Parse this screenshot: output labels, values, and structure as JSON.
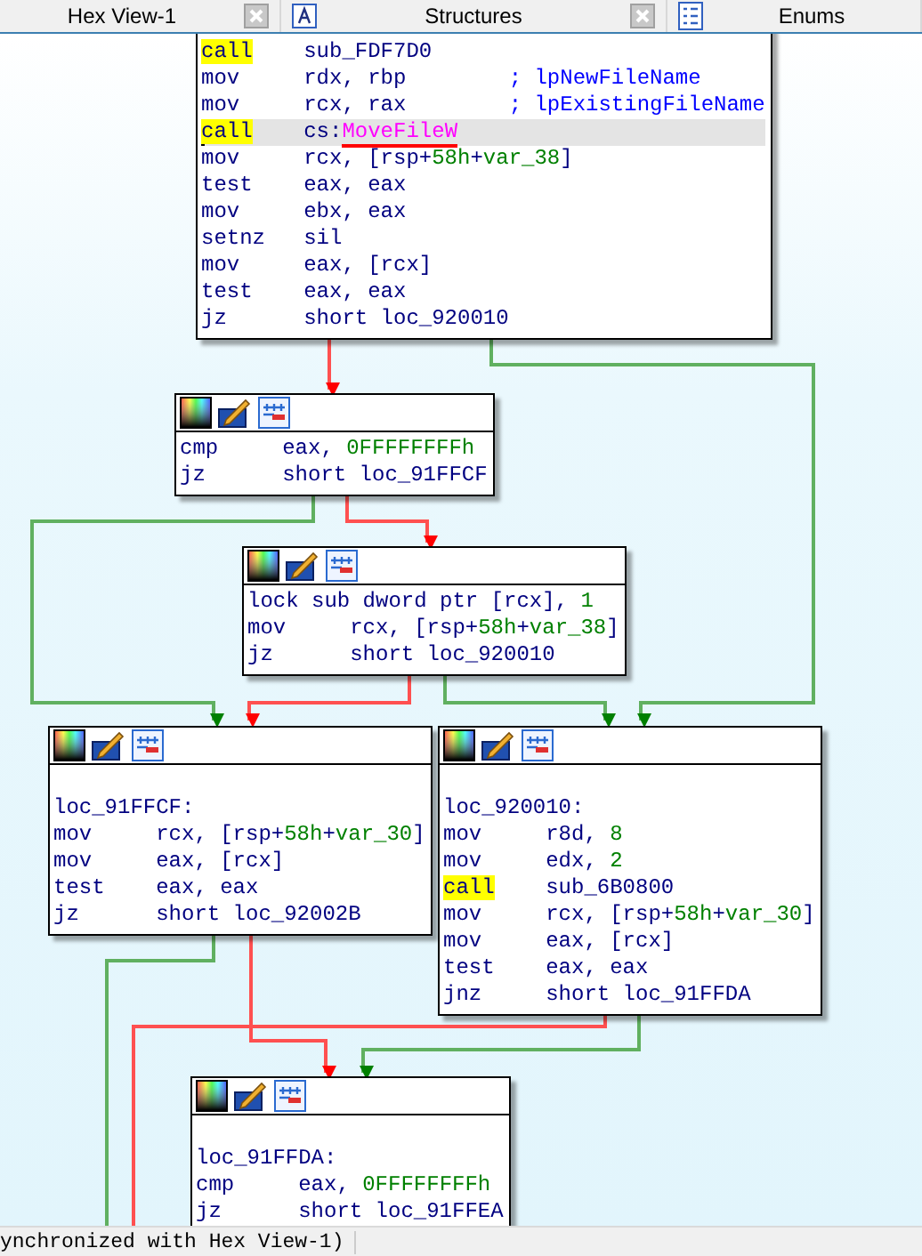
{
  "tabs": [
    {
      "label": "Hex View-1",
      "kind": "closable"
    },
    {
      "label": "Structures",
      "kind": "structures"
    },
    {
      "label": "Enums",
      "kind": "enums"
    }
  ],
  "graph": {
    "nodes": [
      {
        "lines": [
          {
            "mnemonic": "call",
            "highlight": true,
            "selected": false,
            "operands": [
              {
                "text": "sub_FDF7D0",
                "kind": "text"
              }
            ]
          },
          {
            "mnemonic": "mov",
            "highlight": false,
            "selected": false,
            "operands": [
              {
                "text": "rdx, rbp",
                "kind": "text"
              }
            ],
            "comment": "; lpNewFileName"
          },
          {
            "mnemonic": "mov",
            "highlight": false,
            "selected": false,
            "operands": [
              {
                "text": "rcx, rax",
                "kind": "text"
              }
            ],
            "comment": "; lpExistingFileName"
          },
          {
            "mnemonic": "call",
            "highlight": true,
            "selected": true,
            "operands": [
              {
                "text": "cs:",
                "kind": "text"
              },
              {
                "text": "MoveFileW",
                "kind": "import"
              }
            ]
          },
          {
            "mnemonic": "mov",
            "highlight": false,
            "selected": false,
            "operands": [
              {
                "text": "rcx, [rsp+",
                "kind": "text"
              },
              {
                "text": "58h",
                "kind": "number"
              },
              {
                "text": "+",
                "kind": "text"
              },
              {
                "text": "var_38",
                "kind": "number"
              },
              {
                "text": "]",
                "kind": "text"
              }
            ]
          },
          {
            "mnemonic": "test",
            "highlight": false,
            "selected": false,
            "operands": [
              {
                "text": "eax, eax",
                "kind": "text"
              }
            ]
          },
          {
            "mnemonic": "mov",
            "highlight": false,
            "selected": false,
            "operands": [
              {
                "text": "ebx, eax",
                "kind": "text"
              }
            ]
          },
          {
            "mnemonic": "setnz",
            "highlight": false,
            "selected": false,
            "operands": [
              {
                "text": "sil",
                "kind": "text"
              }
            ]
          },
          {
            "mnemonic": "mov",
            "highlight": false,
            "selected": false,
            "operands": [
              {
                "text": "eax, [rcx]",
                "kind": "text"
              }
            ]
          },
          {
            "mnemonic": "test",
            "highlight": false,
            "selected": false,
            "operands": [
              {
                "text": "eax, eax",
                "kind": "text"
              }
            ]
          },
          {
            "mnemonic": "jz",
            "highlight": false,
            "selected": false,
            "operands": [
              {
                "text": "short loc_920010",
                "kind": "text"
              }
            ]
          }
        ]
      },
      {
        "lines": [
          {
            "mnemonic": "cmp",
            "highlight": false,
            "operands": [
              {
                "text": "eax, ",
                "kind": "text"
              },
              {
                "text": "0FFFFFFFFh",
                "kind": "number"
              }
            ]
          },
          {
            "mnemonic": "jz",
            "highlight": false,
            "operands": [
              {
                "text": "short loc_91FFCF",
                "kind": "text"
              }
            ]
          }
        ]
      },
      {
        "lines": [
          {
            "mnemonic": "lock sub",
            "highlight": false,
            "operands": [
              {
                "text": "dword ptr [rcx], ",
                "kind": "text"
              },
              {
                "text": "1",
                "kind": "number"
              }
            ]
          },
          {
            "mnemonic": "mov",
            "highlight": false,
            "operands": [
              {
                "text": "rcx, [rsp+",
                "kind": "text"
              },
              {
                "text": "58h",
                "kind": "number"
              },
              {
                "text": "+",
                "kind": "text"
              },
              {
                "text": "var_38",
                "kind": "number"
              },
              {
                "text": "]",
                "kind": "text"
              }
            ]
          },
          {
            "mnemonic": "jz",
            "highlight": false,
            "operands": [
              {
                "text": "short loc_920010",
                "kind": "text"
              }
            ]
          }
        ]
      },
      {
        "label": "loc_91FFCF:",
        "lines": [
          {
            "mnemonic": "mov",
            "highlight": false,
            "operands": [
              {
                "text": "rcx, [rsp+",
                "kind": "text"
              },
              {
                "text": "58h",
                "kind": "number"
              },
              {
                "text": "+",
                "kind": "text"
              },
              {
                "text": "var_30",
                "kind": "number"
              },
              {
                "text": "]",
                "kind": "text"
              }
            ]
          },
          {
            "mnemonic": "mov",
            "highlight": false,
            "operands": [
              {
                "text": "eax, [rcx]",
                "kind": "text"
              }
            ]
          },
          {
            "mnemonic": "test",
            "highlight": false,
            "operands": [
              {
                "text": "eax, eax",
                "kind": "text"
              }
            ]
          },
          {
            "mnemonic": "jz",
            "highlight": false,
            "operands": [
              {
                "text": "short loc_92002B",
                "kind": "text"
              }
            ]
          }
        ]
      },
      {
        "label": "loc_920010:",
        "lines": [
          {
            "mnemonic": "mov",
            "highlight": false,
            "operands": [
              {
                "text": "r8d, ",
                "kind": "text"
              },
              {
                "text": "8",
                "kind": "number"
              }
            ]
          },
          {
            "mnemonic": "mov",
            "highlight": false,
            "operands": [
              {
                "text": "edx, ",
                "kind": "text"
              },
              {
                "text": "2",
                "kind": "number"
              }
            ]
          },
          {
            "mnemonic": "call",
            "highlight": true,
            "operands": [
              {
                "text": "sub_6B0800",
                "kind": "text"
              }
            ]
          },
          {
            "mnemonic": "mov",
            "highlight": false,
            "operands": [
              {
                "text": "rcx, [rsp+",
                "kind": "text"
              },
              {
                "text": "58h",
                "kind": "number"
              },
              {
                "text": "+",
                "kind": "text"
              },
              {
                "text": "var_30",
                "kind": "number"
              },
              {
                "text": "]",
                "kind": "text"
              }
            ]
          },
          {
            "mnemonic": "mov",
            "highlight": false,
            "operands": [
              {
                "text": "eax, [rcx]",
                "kind": "text"
              }
            ]
          },
          {
            "mnemonic": "test",
            "highlight": false,
            "operands": [
              {
                "text": "eax, eax",
                "kind": "text"
              }
            ]
          },
          {
            "mnemonic": "jnz",
            "highlight": false,
            "operands": [
              {
                "text": "short loc_91FFDA",
                "kind": "text"
              }
            ]
          }
        ]
      },
      {
        "label": "loc_91FFDA:",
        "lines": [
          {
            "mnemonic": "cmp",
            "highlight": false,
            "operands": [
              {
                "text": "eax, ",
                "kind": "text"
              },
              {
                "text": "0FFFFFFFFh",
                "kind": "number"
              }
            ]
          },
          {
            "mnemonic": "jz",
            "highlight": false,
            "operands": [
              {
                "text": "short loc_91FFEA",
                "kind": "text"
              }
            ]
          }
        ]
      }
    ]
  },
  "status_bar": {
    "text": "ynchronized with Hex View-1)"
  }
}
